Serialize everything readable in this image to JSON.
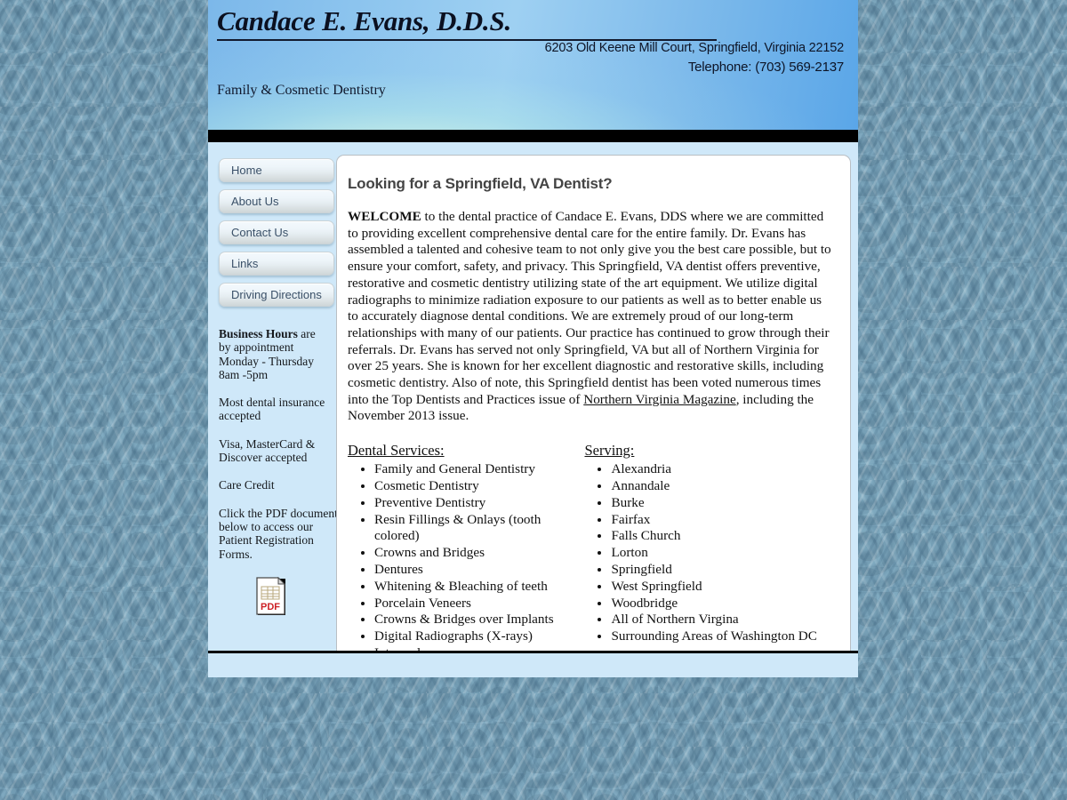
{
  "site": {
    "background_color": "#6e94a9",
    "banner_color_left": "#7cb8ea",
    "banner_color_accent": "#cdf2e6",
    "body_band_color": "#cfe8f9",
    "card_color": "#ffffff"
  },
  "header": {
    "practice_name": "Candace E. Evans, D.D.S.",
    "address": "6203 Old Keene Mill Court, Springfield, Virginia  22152",
    "telephone": "Telephone: (703) 569-2137",
    "tagline": "Family & Cosmetic Dentistry"
  },
  "sidebar": {
    "nav": [
      {
        "label": "Home"
      },
      {
        "label": "About Us"
      },
      {
        "label": "Contact Us"
      },
      {
        "label": "Links"
      },
      {
        "label": "Driving Directions"
      }
    ],
    "hours": {
      "label": "Business Hours",
      "rest": " are",
      "line2": "by appointment",
      "line3": "Monday - Thursday",
      "line4": "8am -5pm"
    },
    "insurance": "Most dental insurance accepted",
    "cards": "Visa, MasterCard & Discover accepted",
    "care_credit": "Care Credit",
    "pdf_note": "Click the PDF document below to access our Patient Registration Forms.",
    "pdf_icon_label": "PDF"
  },
  "main": {
    "heading": "Looking for a Springfield, VA Dentist?",
    "welcome_lead": "WELCOME",
    "welcome_body_1": " to the dental practice of Candace E. Evans, DDS where we are committed to providing excellent comprehensive dental care for the entire family.  Dr. Evans has assembled a talented and cohesive team to not only give you the best care possible, but to ensure your comfort, safety, and privacy.  This Springfield, VA dentist offers preventive, restorative and cosmetic dentistry utilizing state of the art equipment.  We utilize digital radiographs to minimize radiation exposure to our patients as well as to better enable us to accurately diagnose dental conditions.  We are extremely proud of our long-term relationships with many of our patients.  Our practice has continued to grow through their referrals.  Dr. Evans has served not only Springfield, VA but all of Northern Virginia for over 25 years.  She is known for her excellent diagnostic and restorative skills, including cosmetic dentistry. Also of note, this Springfield dentist has been voted numerous times into the Top Dentists and Practices issue of ",
    "magazine_link": "Northern Virginia Magazine",
    "welcome_body_2": ", including the November 2013 issue.",
    "services_heading": "Dental Services: ",
    "services": [
      "Family and General Dentistry",
      "Cosmetic Dentistry",
      "Preventive Dentistry",
      "Resin Fillings & Onlays (tooth colored)",
      "Crowns and Bridges",
      "Dentures",
      "Whitening & Bleaching of teeth",
      "Porcelain Veneers",
      "Crowns & Bridges over Implants",
      "Digital Radiographs (X-rays)",
      "Intraoral camera"
    ],
    "serving_heading": "Serving: ",
    "serving": [
      "Alexandria",
      "Annandale",
      "Burke",
      "Fairfax",
      "Falls Church",
      "Lorton",
      "Springfield",
      "West Springfield",
      "Woodbridge",
      "All of Northern Virgina",
      "Surrounding Areas of Washington DC"
    ]
  }
}
